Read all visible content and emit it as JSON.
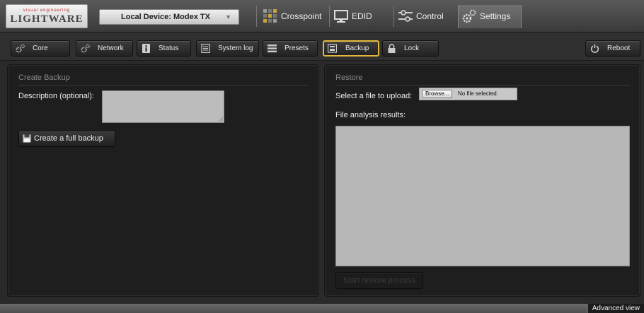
{
  "header": {
    "logo_tagline": "visual engineering",
    "logo_brand": "LIGHTWARE",
    "device_selector": "Local Device: Modex TX",
    "tabs": [
      {
        "label": "Crosspoint",
        "icon": "crosspoint-grid-icon",
        "active": false
      },
      {
        "label": "EDID",
        "icon": "monitor-icon",
        "active": false
      },
      {
        "label": "Control",
        "icon": "sliders-icon",
        "active": false
      },
      {
        "label": "Settings",
        "icon": "gears-icon",
        "active": true
      }
    ]
  },
  "toolbar": {
    "buttons": [
      {
        "label": "Core",
        "icon": "gears-icon"
      },
      {
        "label": "Network",
        "icon": "gears-icon"
      },
      {
        "label": "Status",
        "icon": "info-icon"
      },
      {
        "label": "System log",
        "icon": "document-icon"
      },
      {
        "label": "Presets",
        "icon": "list-icon"
      },
      {
        "label": "Backup",
        "icon": "backup-icon",
        "active": true
      },
      {
        "label": "Lock",
        "icon": "lock-icon"
      }
    ],
    "reboot_label": "Reboot"
  },
  "backup": {
    "title": "Create Backup",
    "description_label": "Description (optional):",
    "description_value": "",
    "create_button": "Create a full backup"
  },
  "restore": {
    "title": "Restore",
    "upload_label": "Select a file to upload:",
    "browse_button": "Browse...",
    "file_status": "No file selected.",
    "analysis_label": "File analysis results:",
    "analysis_results": "",
    "start_button": "Start restore process",
    "start_enabled": false
  },
  "footer": {
    "advanced_view": "Advanced view"
  },
  "colors": {
    "active_outline": "#e2b73b",
    "panel_bg": "#1e1e1e",
    "field_bg": "#bcbcbc"
  }
}
